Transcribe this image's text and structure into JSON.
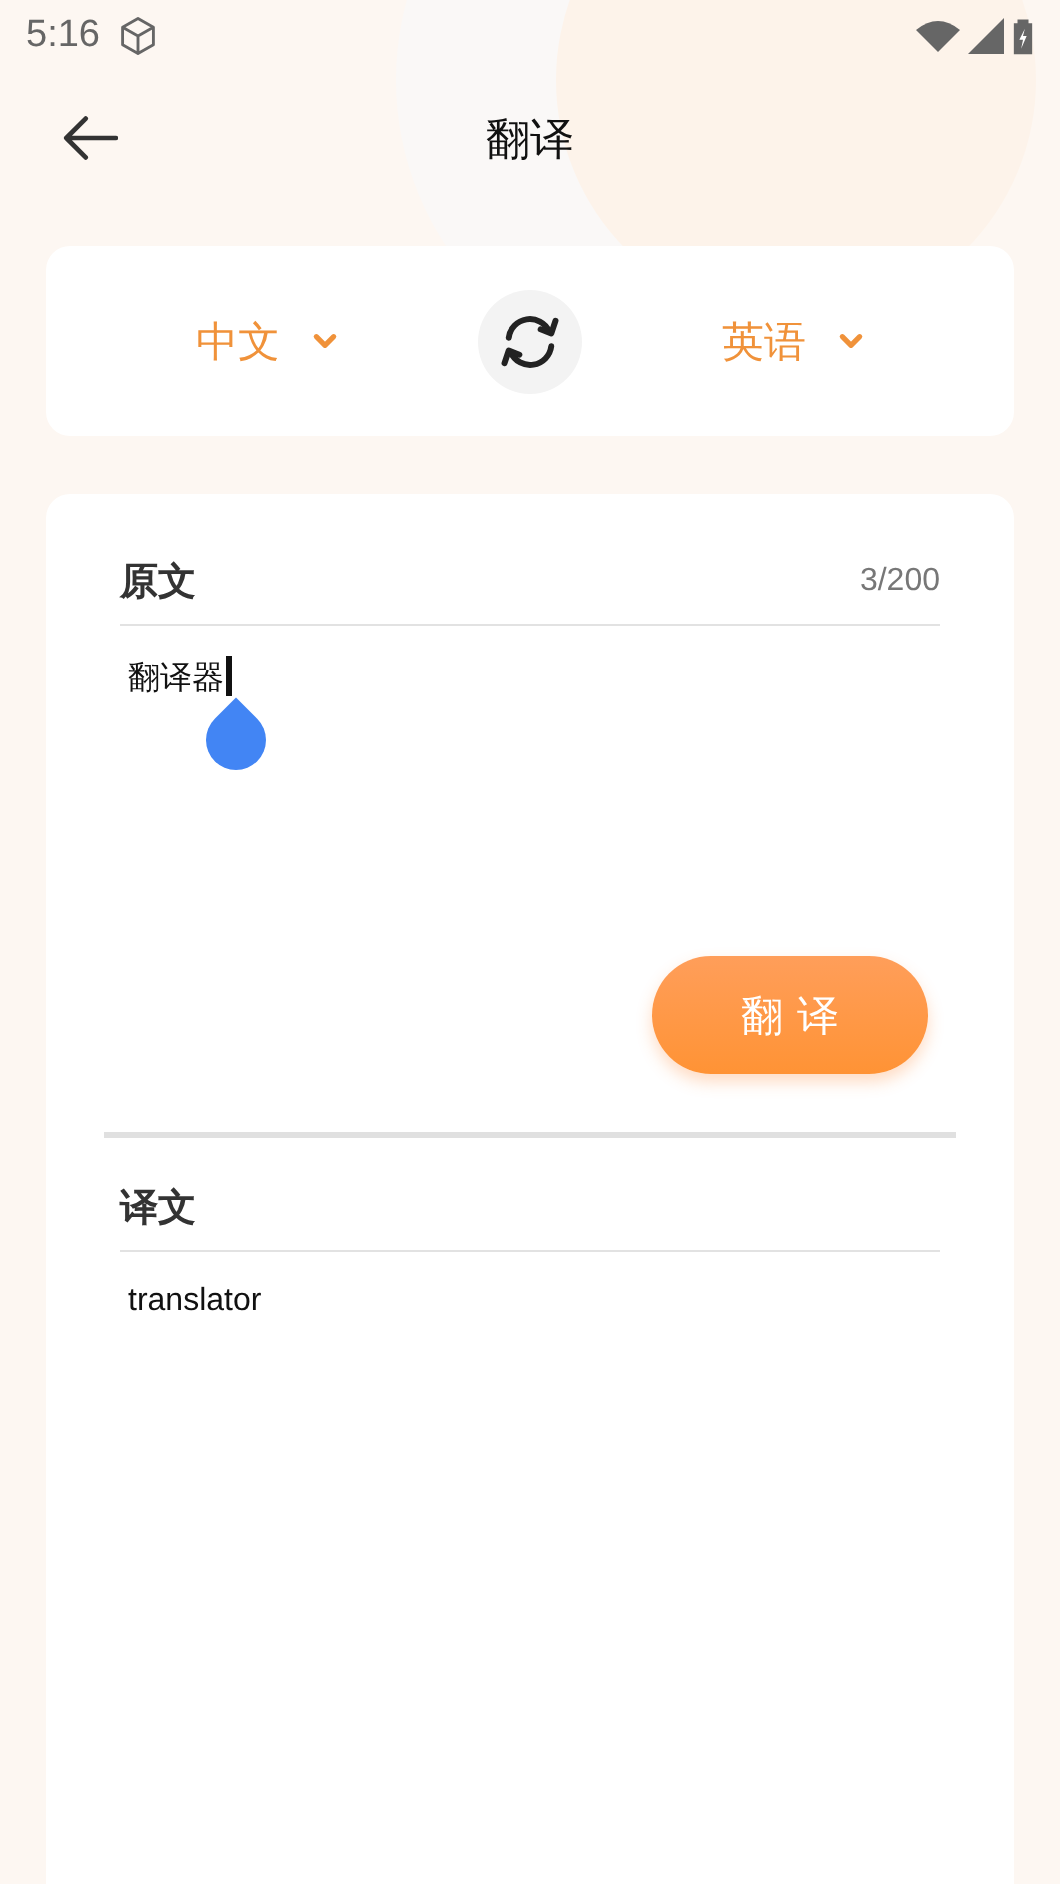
{
  "status_bar": {
    "time": "5:16"
  },
  "header": {
    "title": "翻译"
  },
  "languages": {
    "source": "中文",
    "target": "英语"
  },
  "source": {
    "label": "原文",
    "count": "3/200",
    "value": "翻译器"
  },
  "translate_button": "翻 译",
  "result": {
    "label": "译文",
    "text": "translator"
  }
}
